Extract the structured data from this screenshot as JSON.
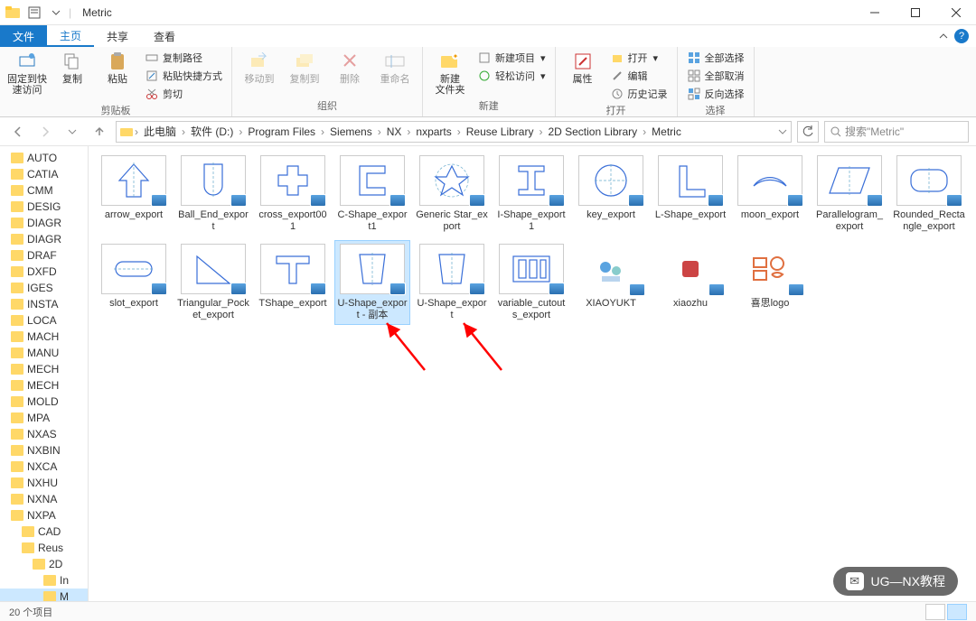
{
  "window": {
    "title": "Metric"
  },
  "tabs": {
    "file": "文件",
    "home": "主页",
    "share": "共享",
    "view": "查看"
  },
  "ribbon": {
    "pin": {
      "label": "固定到快\n速访问"
    },
    "copy": "复制",
    "paste": "粘贴",
    "copypath": "复制路径",
    "pasteshortcut": "粘贴快捷方式",
    "cut": "剪切",
    "clipboard_group": "剪贴板",
    "moveto": "移动到",
    "copyto": "复制到",
    "delete": "删除",
    "rename": "重命名",
    "organize_group": "组织",
    "newfolder": "新建\n文件夹",
    "newitem": "新建项目",
    "easyaccess": "轻松访问",
    "new_group": "新建",
    "properties": "属性",
    "open": "打开",
    "edit": "编辑",
    "history": "历史记录",
    "open_group": "打开",
    "selectall": "全部选择",
    "selectnone": "全部取消",
    "invert": "反向选择",
    "select_group": "选择"
  },
  "breadcrumb": [
    "此电脑",
    "软件 (D:)",
    "Program Files",
    "Siemens",
    "NX",
    "nxparts",
    "Reuse Library",
    "2D Section Library",
    "Metric"
  ],
  "search": {
    "placeholder": "搜索\"Metric\""
  },
  "nav": [
    {
      "label": "AUTO",
      "indent": 0
    },
    {
      "label": "CATIA",
      "indent": 0
    },
    {
      "label": "CMM",
      "indent": 0
    },
    {
      "label": "DESIG",
      "indent": 0
    },
    {
      "label": "DIAGR",
      "indent": 0
    },
    {
      "label": "DIAGR",
      "indent": 0
    },
    {
      "label": "DRAF",
      "indent": 0
    },
    {
      "label": "DXFD",
      "indent": 0
    },
    {
      "label": "IGES",
      "indent": 0
    },
    {
      "label": "INSTA",
      "indent": 0
    },
    {
      "label": "LOCA",
      "indent": 0
    },
    {
      "label": "MACH",
      "indent": 0
    },
    {
      "label": "MANU",
      "indent": 0
    },
    {
      "label": "MECH",
      "indent": 0
    },
    {
      "label": "MECH",
      "indent": 0
    },
    {
      "label": "MOLD",
      "indent": 0
    },
    {
      "label": "MPA",
      "indent": 0
    },
    {
      "label": "NXAS",
      "indent": 0
    },
    {
      "label": "NXBIN",
      "indent": 0
    },
    {
      "label": "NXCA",
      "indent": 0
    },
    {
      "label": "NXHU",
      "indent": 0
    },
    {
      "label": "NXNA",
      "indent": 0
    },
    {
      "label": "NXPA",
      "indent": 0
    },
    {
      "label": "CAD",
      "indent": 1
    },
    {
      "label": "Reus",
      "indent": 1
    },
    {
      "label": "2D",
      "indent": 2
    },
    {
      "label": "In",
      "indent": 3
    },
    {
      "label": "M",
      "indent": 3,
      "sel": true
    }
  ],
  "files": [
    {
      "label": "arrow_export",
      "shape": "arrow"
    },
    {
      "label": "Ball_End_export",
      "shape": "ballend"
    },
    {
      "label": "cross_export001",
      "shape": "cross"
    },
    {
      "label": "C-Shape_export1",
      "shape": "cshape"
    },
    {
      "label": "Generic Star_export",
      "shape": "star"
    },
    {
      "label": "I-Shape_export1",
      "shape": "ishape"
    },
    {
      "label": "key_export",
      "shape": "key"
    },
    {
      "label": "L-Shape_export",
      "shape": "lshape"
    },
    {
      "label": "moon_export",
      "shape": "moon"
    },
    {
      "label": "Parallelogram_export",
      "shape": "para"
    },
    {
      "label": "Rounded_Rectangle_export",
      "shape": "rrect"
    },
    {
      "label": "slot_export",
      "shape": "slot"
    },
    {
      "label": "Triangular_Pocket_export",
      "shape": "tri"
    },
    {
      "label": "TShape_export",
      "shape": "tshape"
    },
    {
      "label": "U-Shape_export - 副本",
      "shape": "ushape",
      "sel": true
    },
    {
      "label": "U-Shape_export",
      "shape": "ushape"
    },
    {
      "label": "variable_cutouts_export",
      "shape": "cutouts"
    },
    {
      "label": "XIAOYUKT",
      "shape": "icon1",
      "plain": true
    },
    {
      "label": "xiaozhu",
      "shape": "icon2",
      "plain": true
    },
    {
      "label": "喜思logo",
      "shape": "icon3",
      "plain": true
    }
  ],
  "status": {
    "count": "20 个项目"
  },
  "watermark": "UG—NX教程"
}
